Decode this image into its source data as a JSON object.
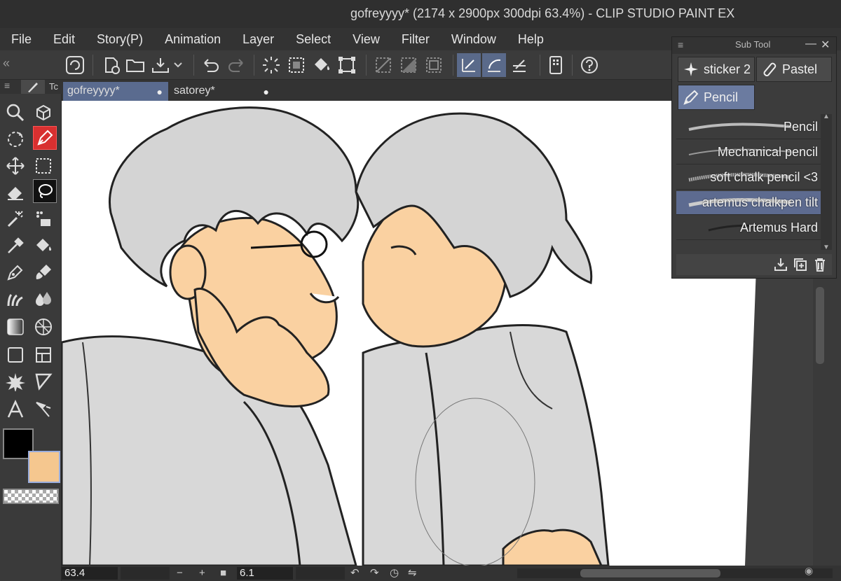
{
  "window": {
    "title": "gofreyyyy* (2174 x 2900px 300dpi 63.4%)  - CLIP STUDIO PAINT EX"
  },
  "menu": [
    "File",
    "Edit",
    "Story(P)",
    "Animation",
    "Layer",
    "Select",
    "View",
    "Filter",
    "Window",
    "Help"
  ],
  "tool_panel": {
    "tab_label": "Tc"
  },
  "documents": [
    {
      "name": "gofreyyyy*",
      "active": true
    },
    {
      "name": "satorey*",
      "active": false
    }
  ],
  "subtool": {
    "title": "Sub Tool",
    "groups": [
      "sticker 2",
      "Pastel",
      "Pencil"
    ],
    "selected_group": "Pencil",
    "brushes": [
      "Pencil",
      "Mechanical pencil",
      "soft chalk pencil <3",
      "artemus chalkpen tilt",
      "Artemus Hard"
    ],
    "selected_brush": "artemus chalkpen tilt"
  },
  "colors": {
    "main": "#000000",
    "sub": "#f5c78f"
  },
  "status": {
    "zoom": "63.4",
    "brush_size": "6.1",
    "minus": "−",
    "plus": "+"
  }
}
